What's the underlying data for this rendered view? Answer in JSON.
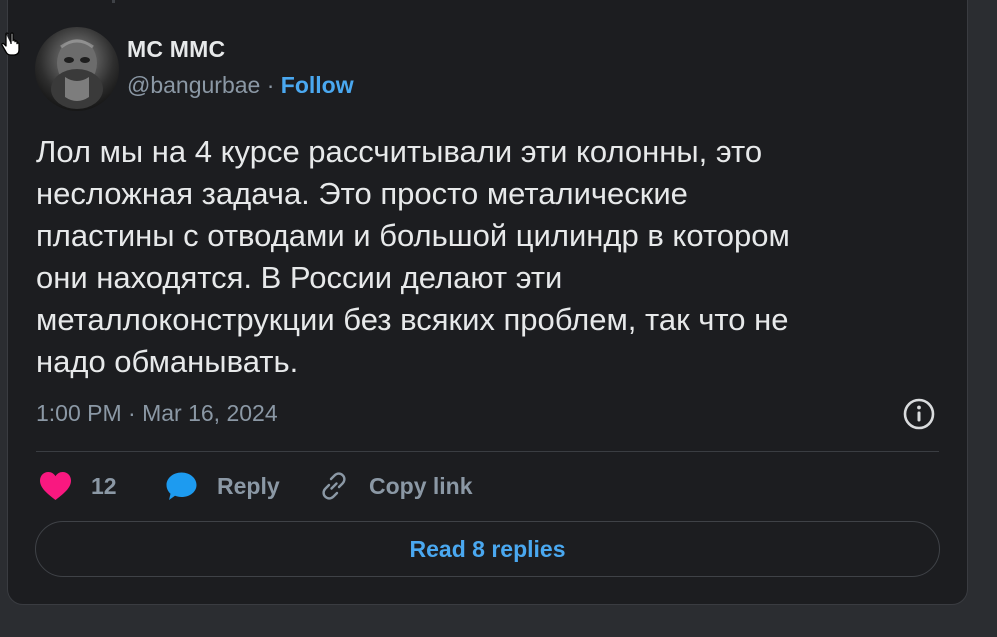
{
  "tweet": {
    "display_name": "МС ММС",
    "handle": "@bangurbae",
    "separator": " · ",
    "follow_label": "Follow",
    "text": "Лол мы на 4 курсе рассчитывали эти колонны, это\nнесложная задача. Это просто металические\nпластины с отводами и большой цилиндр в котором\nони находятся. В России делают эти\nметаллоконструкции без всяких проблем, так что не\nнадо обманывать.",
    "timestamp": "1:00 PM · Mar 16, 2024"
  },
  "actions": {
    "like_count": "12",
    "reply_label": "Reply",
    "copy_link_label": "Copy link"
  },
  "read_replies_label": "Read 8 replies",
  "icons": {
    "like": "heart-icon",
    "reply": "speech-bubble-icon",
    "copy": "link-icon",
    "info": "info-icon",
    "cursor": "hand-pointer-icon"
  },
  "colors": {
    "accent": "#4aa8f0",
    "like": "#f91880",
    "reply_icon": "#1d9bf0",
    "text": "#e7e9ea",
    "muted": "#8b98a5",
    "card_bg": "#1c1d20",
    "page_bg": "#2b2d31"
  }
}
